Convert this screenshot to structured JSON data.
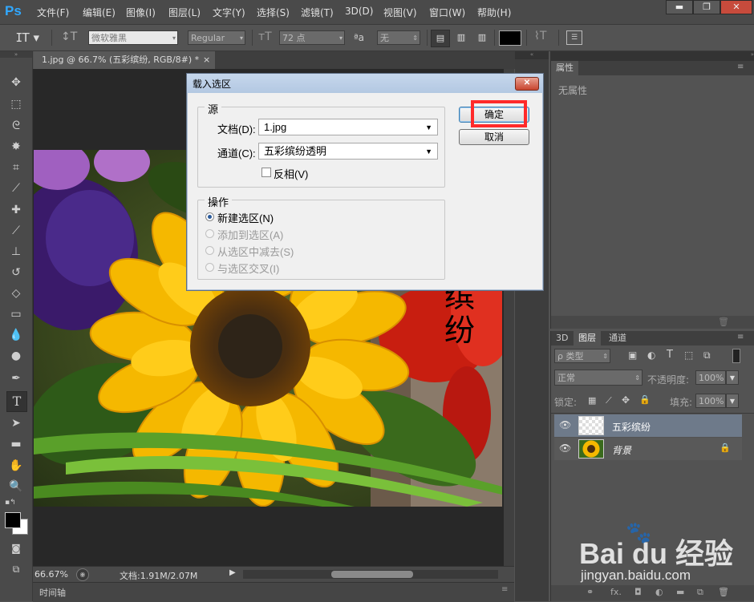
{
  "app": {
    "logo": "Ps"
  },
  "menu": [
    "文件(F)",
    "编辑(E)",
    "图像(I)",
    "图层(L)",
    "文字(Y)",
    "选择(S)",
    "滤镜(T)",
    "3D(D)",
    "视图(V)",
    "窗口(W)",
    "帮助(H)"
  ],
  "window_controls": {
    "minimize": "▬",
    "restore": "❐",
    "close": "✕"
  },
  "options": {
    "font_family": "微软雅黑",
    "font_style": "Regular",
    "font_size": "72 点",
    "aa_label": "ªa",
    "anti_alias": "无"
  },
  "document_tab": {
    "title": "1.jpg @ 66.7% (五彩缤纷, RGB/8#) *",
    "close": "×"
  },
  "canvas_text": "缤纷",
  "status": {
    "zoom": "66.67%",
    "doc": "文档:1.91M/2.07M"
  },
  "timeline": {
    "label": "时间轴"
  },
  "properties_panel": {
    "tab": "属性",
    "empty": "无属性"
  },
  "layers_panel": {
    "tabs": [
      "3D",
      "图层",
      "通道"
    ],
    "filter": "ρ 类型",
    "blend_mode": "正常",
    "opacity_label": "不透明度:",
    "opacity_value": "100%",
    "lock_label": "锁定:",
    "fill_label": "填充:",
    "fill_value": "100%",
    "layers": [
      {
        "name": "五彩缤纷",
        "selected": true
      },
      {
        "name": "背景",
        "selected": false,
        "locked": true
      }
    ],
    "footer_fx": "fx."
  },
  "dialog": {
    "title": "载入选区",
    "source_legend": "源",
    "document_label": "文档(D):",
    "document_value": "1.jpg",
    "channel_label": "通道(C):",
    "channel_value": "五彩缤纷透明",
    "invert_label": "反相(V)",
    "operation_legend": "操作",
    "ops": [
      "新建选区(N)",
      "添加到选区(A)",
      "从选区中减去(S)",
      "与选区交叉(I)"
    ],
    "ok_label": "确定",
    "cancel_label": "取消"
  },
  "watermark": {
    "brand": "Bai du 经验",
    "url": "jingyan.baidu.com"
  },
  "colors": {
    "highlight": "#ff2a2a",
    "accent": "#31a8ff"
  }
}
